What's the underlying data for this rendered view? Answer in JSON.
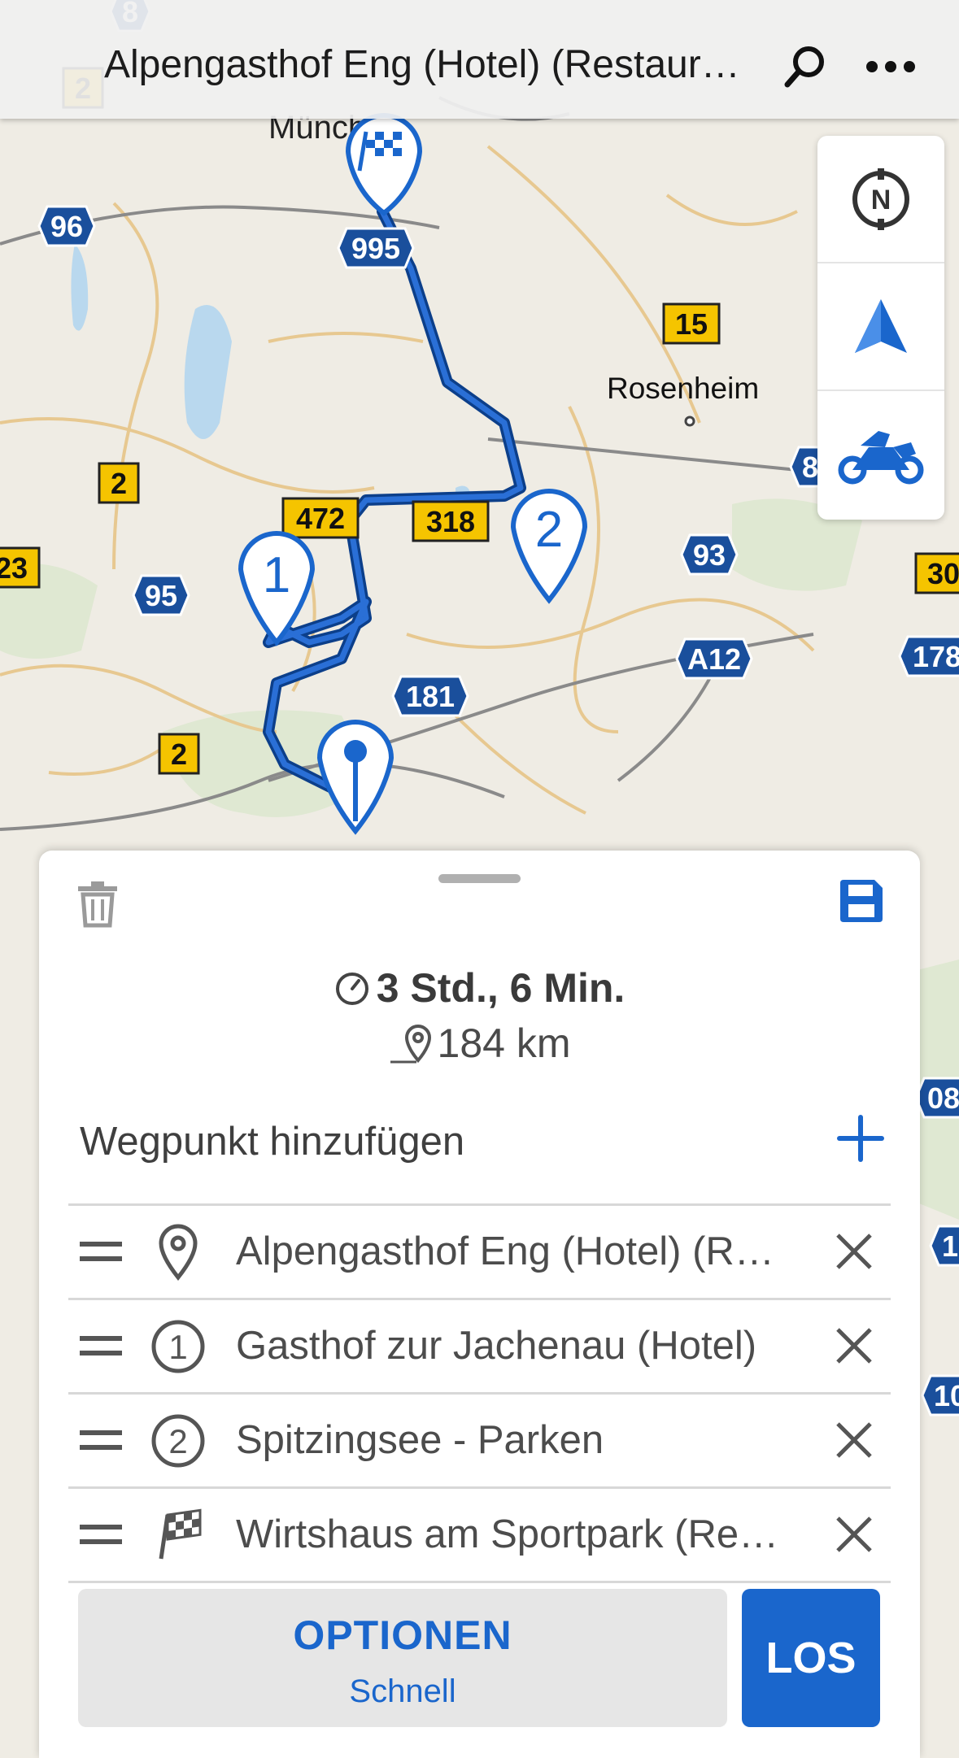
{
  "header": {
    "title": "Alpengasthof Eng (Hotel) (Restaurant)"
  },
  "map": {
    "city_labels": [
      "München",
      "Rosenheim"
    ],
    "road_shields": [
      "8",
      "2",
      "96",
      "995",
      "15",
      "2",
      "472",
      "318",
      "95",
      "23",
      "2",
      "93",
      "A12",
      "181",
      "178",
      "30",
      "8",
      "08",
      "1",
      "10"
    ],
    "waypoint_numbers": [
      "1",
      "2"
    ]
  },
  "controls": {
    "items": [
      "compass-north",
      "navigation-arrow",
      "motorcycle-profile"
    ]
  },
  "route": {
    "duration": "3 Std., 6 Min.",
    "distance": "184 km",
    "add_waypoint_label": "Wegpunkt hinzufügen",
    "waypoints": [
      {
        "icon": "location-pin-icon",
        "label": "Alpengasthof Eng (Hotel) (Restaurant)"
      },
      {
        "icon": "circle-1-icon",
        "label": "Gasthof zur Jachenau (Hotel)"
      },
      {
        "icon": "circle-2-icon",
        "label": "Spitzingsee - Parken"
      },
      {
        "icon": "checkered-flag-icon",
        "label": "Wirtshaus am Sportpark (Restaurant)"
      }
    ]
  },
  "actions": {
    "options_label": "OPTIONEN",
    "options_sub": "Schnell",
    "go_label": "LOS"
  },
  "colors": {
    "accent": "#1a66cc",
    "route_line": "#0c3f8a",
    "highway_shield": "#1a4f9c",
    "road_shield": "#f5c400"
  }
}
